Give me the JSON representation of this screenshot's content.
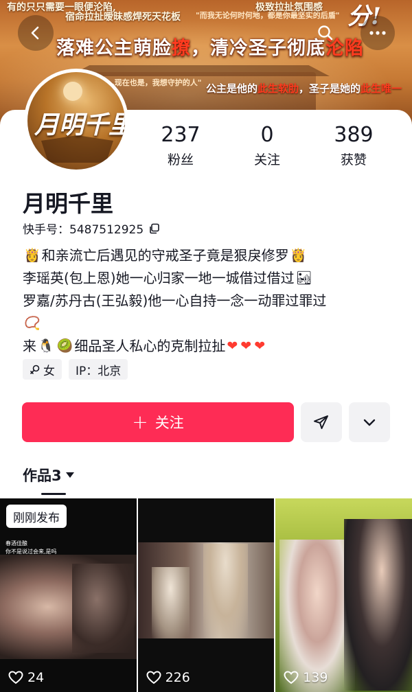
{
  "banner": {
    "top_left": "有的只只需要一眼便沦陷,",
    "top_left2": "宿命拉扯暧昧感焊死天花板",
    "quote1": "\"而我无论何时何地，都是你最坚实的后盾\"",
    "top_right": "极致拉扯氛围感",
    "big": "分!",
    "headline_a": "落难公主萌脸",
    "headline_b": "撩",
    "headline_c": "，清冷圣子彻底",
    "headline_d": "沦陷",
    "quote2": "\"…现在也是，我想守护的人\"",
    "sub_a": "公主是他的",
    "sub_b": "此生软肋",
    "sub_c": "，圣子是她的",
    "sub_d": "此生唯一"
  },
  "avatar": {
    "title": "月明千里"
  },
  "stats": [
    {
      "value": "237",
      "label": "粉丝"
    },
    {
      "value": "0",
      "label": "关注"
    },
    {
      "value": "389",
      "label": "获赞"
    }
  ],
  "profile": {
    "name": "月明千里",
    "kuaishou_id": "快手号：5487512925"
  },
  "bio": {
    "line1": "和亲流亡后遇见的守戒圣子竟是狠戾修罗",
    "line2": "李瑶英(包上恩)她一心归家一地一城借过借过",
    "line3": "罗嘉/苏丹古(王弘毅)他一心自持一念一动罪过罪过",
    "line5a": "来",
    "line5b": "细品圣人私心的克制拉扯"
  },
  "tags": [
    {
      "label": "女"
    },
    {
      "label": "IP：北京"
    }
  ],
  "actions": {
    "follow_label": "关注"
  },
  "works": {
    "tab_label": "作品3"
  },
  "grid": [
    {
      "badge": "刚刚发布",
      "caption": "春酒佳酿\n你不是说过会来,是吗",
      "likes": "24"
    },
    {
      "caption": "",
      "likes": "226"
    },
    {
      "caption": "",
      "likes": "139"
    }
  ]
}
